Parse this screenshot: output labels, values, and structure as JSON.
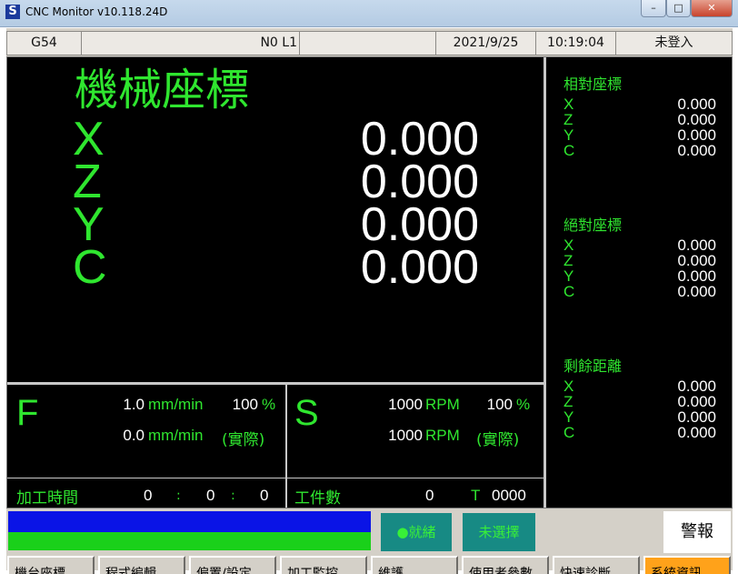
{
  "window": {
    "title": "CNC Monitor v10.118.24D",
    "app_icon": "S",
    "buttons": {
      "minimize": "–",
      "maximize": "□",
      "close": "✕"
    }
  },
  "statusbar": {
    "coord_system": "G54",
    "program": "N0 L1",
    "date": "2021/9/25",
    "time": "10:19:04",
    "user": "未登入"
  },
  "machine": {
    "title": "機械座標",
    "axes": [
      {
        "axis": "X",
        "value": "0.000"
      },
      {
        "axis": "Z",
        "value": "0.000"
      },
      {
        "axis": "Y",
        "value": "0.000"
      },
      {
        "axis": "C",
        "value": "0.000"
      }
    ]
  },
  "side_panels": [
    {
      "title": "相對座標",
      "axes": [
        "X",
        "Z",
        "Y",
        "C"
      ],
      "values": [
        "0.000",
        "0.000",
        "0.000",
        "0.000"
      ]
    },
    {
      "title": "絕對座標",
      "axes": [
        "X",
        "Z",
        "Y",
        "C"
      ],
      "values": [
        "0.000",
        "0.000",
        "0.000",
        "0.000"
      ]
    },
    {
      "title": "剩餘距離",
      "axes": [
        "X",
        "Z",
        "Y",
        "C"
      ],
      "values": [
        "0.000",
        "0.000",
        "0.000",
        "0.000"
      ]
    }
  ],
  "feed": {
    "letter": "F",
    "command_value": "1.0",
    "command_unit": "mm/min",
    "override_value": "100",
    "override_unit": "%",
    "actual_value": "0.0",
    "actual_unit": "mm/min",
    "actual_label": "(實際)"
  },
  "spindle": {
    "letter": "S",
    "command_value": "1000",
    "command_unit": "RPM",
    "override_value": "100",
    "override_unit": "%",
    "actual_value": "1000",
    "actual_unit": "RPM",
    "actual_label": "(實際)"
  },
  "machining_time": {
    "label": "加工時間",
    "h": "0",
    "m": "0",
    "s": "0",
    "sep": ":"
  },
  "workpiece": {
    "label": "工件數",
    "count": "0",
    "tool_label": "T",
    "tool_value": "0000"
  },
  "indicators": {
    "ready": "●就緒",
    "unselected": "未選擇",
    "alarm": "警報"
  },
  "colors": {
    "screen_bg": "#000000",
    "text_green": "#2fe62f",
    "progress_blue": "#0a14e6",
    "progress_green": "#1ad01a",
    "active_key": "#ffa21a"
  },
  "function_keys": [
    "機台座標",
    "程式編輯",
    "偏置/設定",
    "加工監控",
    "維護",
    "使用者參數",
    "快速診斷",
    "系統資訊"
  ]
}
